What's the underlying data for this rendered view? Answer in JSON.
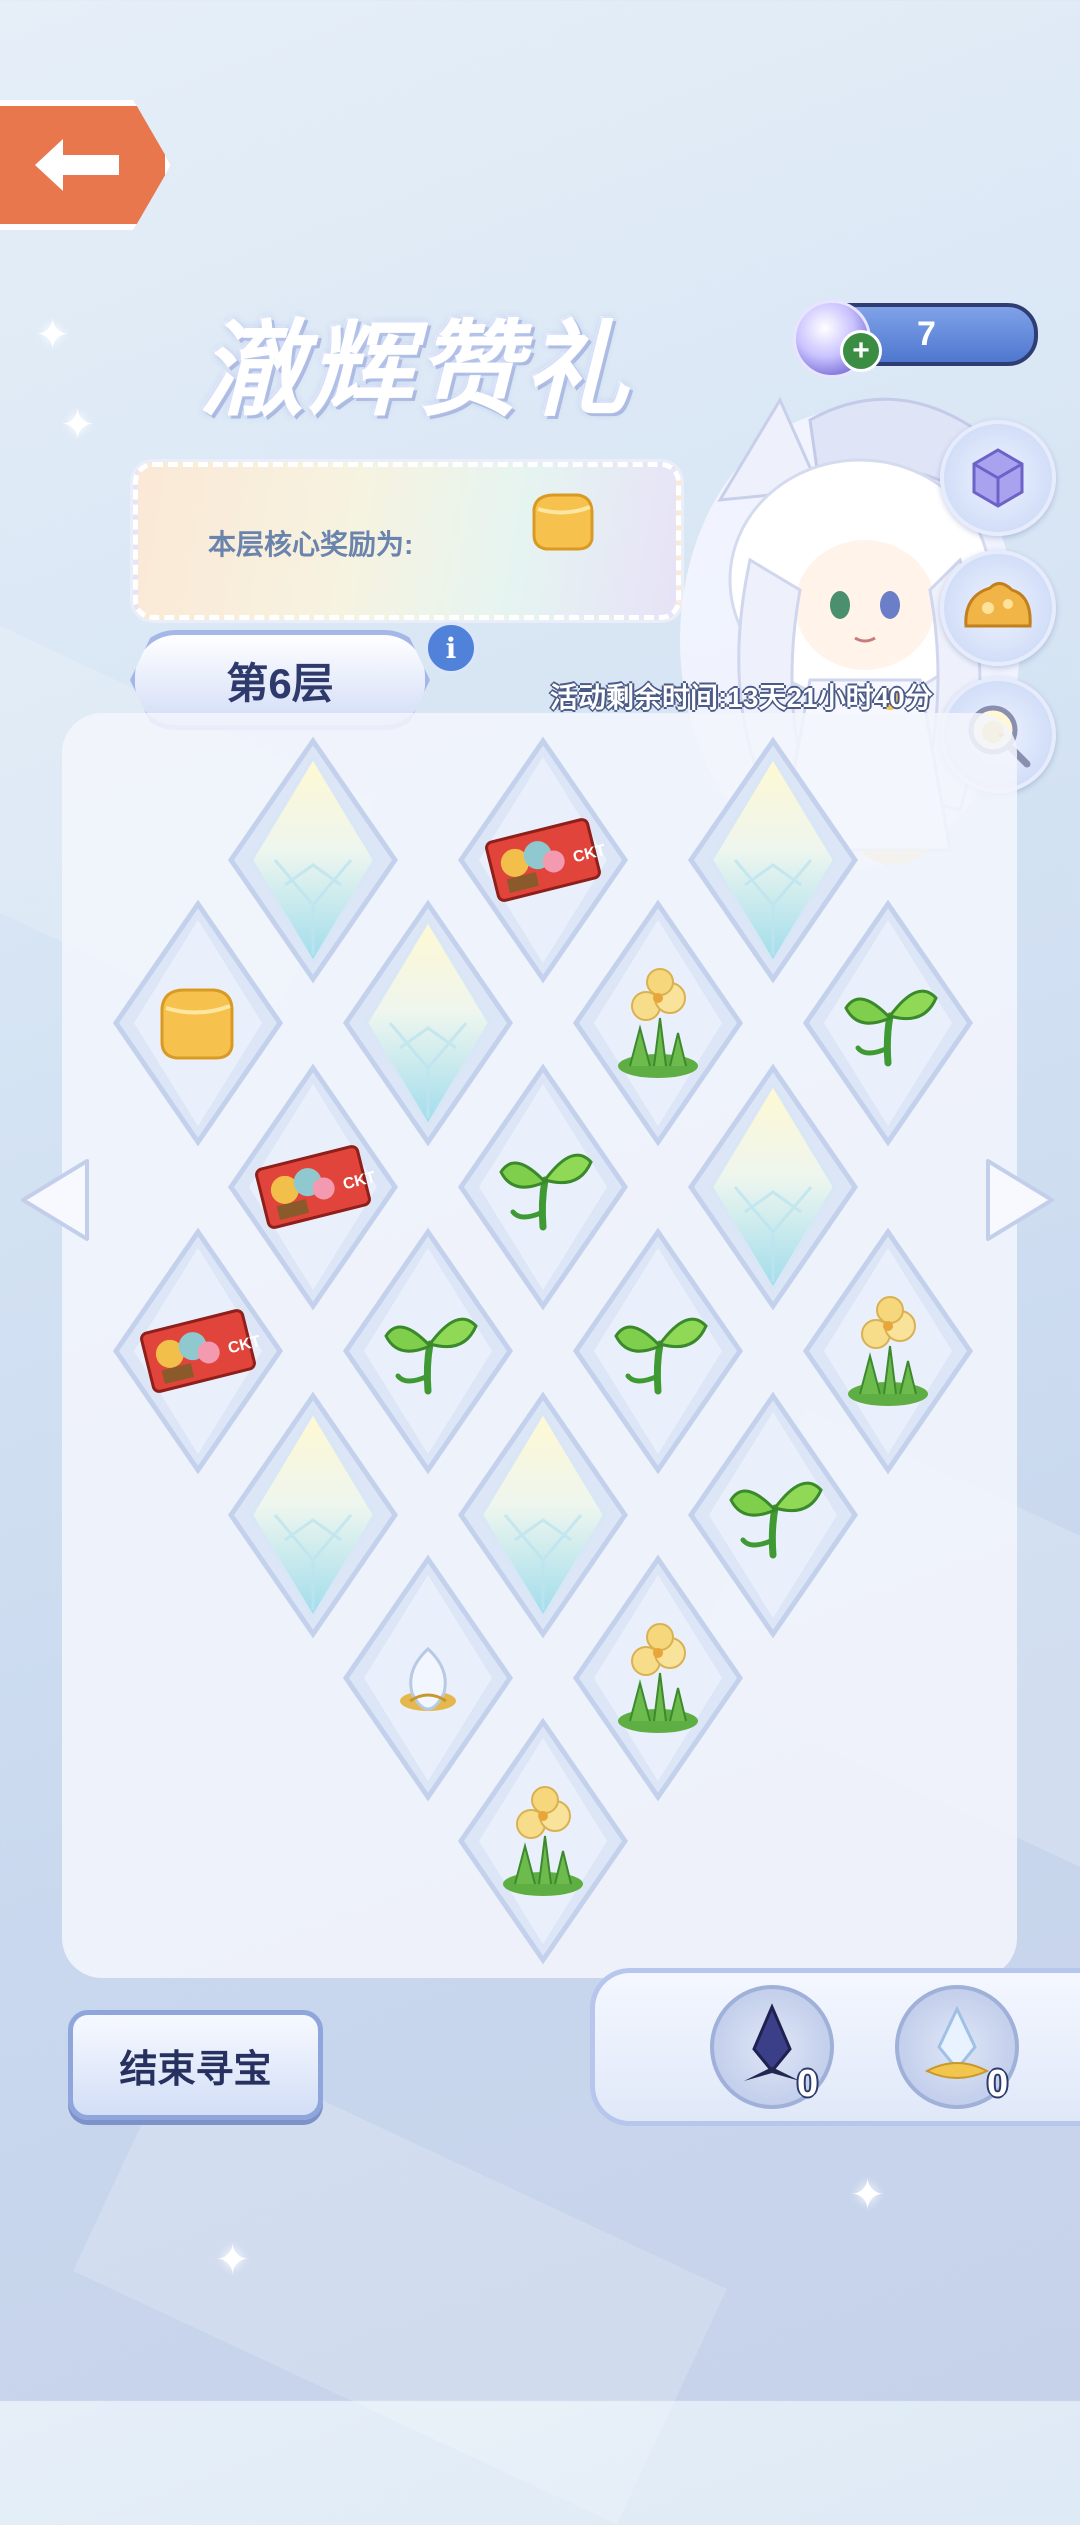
{
  "header": {
    "event_title": "澈辉赞礼",
    "currency_amount": "7",
    "currency_icon": "crystal-orb-icon"
  },
  "reward": {
    "label": "本层核心奖励为:",
    "item_icon": "cheese-icon"
  },
  "floor": {
    "label": "第6层"
  },
  "timer": {
    "text": "活动剩余时间:13天21小时40分"
  },
  "side_buttons": [
    "gem-cube-icon",
    "golden-treasure-icon",
    "search-chick-icon"
  ],
  "board": {
    "tiles": [
      {
        "item": "crystal"
      },
      {
        "item": "ticket"
      },
      {
        "item": "crystal"
      },
      {
        "item": "cheese"
      },
      {
        "item": "crystal"
      },
      {
        "item": "flower"
      },
      {
        "item": "sprout"
      },
      {
        "item": "ticket"
      },
      {
        "item": "sprout"
      },
      {
        "item": "crystal"
      },
      {
        "item": "ticket"
      },
      {
        "item": "sprout"
      },
      {
        "item": "sprout"
      },
      {
        "item": "flower"
      },
      {
        "item": "crystal"
      },
      {
        "item": "crystal"
      },
      {
        "item": "sprout"
      },
      {
        "item": "egg"
      },
      {
        "item": "flower"
      },
      {
        "item": "flower"
      }
    ]
  },
  "actions": {
    "end_label": "结束寻宝"
  },
  "inventory": {
    "slots": [
      {
        "icon": "dark-crystal-icon",
        "count": "0"
      },
      {
        "icon": "light-crystal-icon",
        "count": "0"
      }
    ]
  },
  "colors": {
    "back_button": "#e8774e",
    "currency_bar": "#4e77cf",
    "floor_text": "#2e3a6b",
    "timer_outline": "#4b5a86"
  }
}
